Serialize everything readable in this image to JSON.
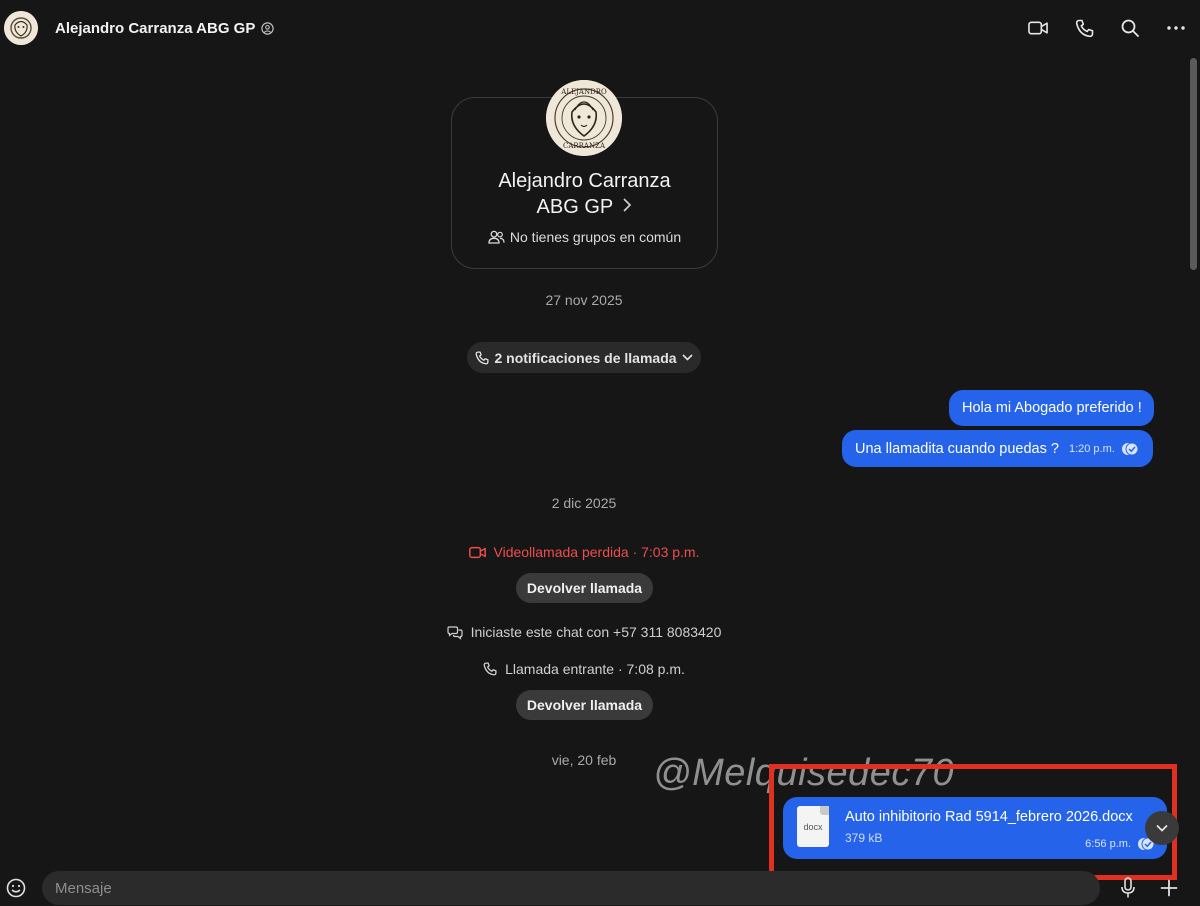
{
  "header": {
    "contact_name": "Alejandro Carranza ABG GP"
  },
  "profile": {
    "avatar_text_top": "ALEJANDRO",
    "avatar_text_bottom": "CARRANZA",
    "name_line1": "Alejandro Carranza",
    "name_line2": "ABG GP",
    "groups_text": "No tienes grupos en común"
  },
  "dates": {
    "first": "27 nov 2025",
    "second": "2 dic 2025",
    "third": "vie, 20 feb"
  },
  "call_notifications": {
    "label": "2 notificaciones de llamada"
  },
  "messages": [
    {
      "text": "Hola mi Abogado preferido !"
    },
    {
      "text": "Una llamadita cuando puedas ?",
      "time": "1:20 p.m."
    }
  ],
  "events": {
    "missed_video_call": "Videollamada perdida · 7:03 p.m.",
    "callback_label": "Devolver llamada",
    "chat_started": "Iniciaste este chat con +57 311 8083420",
    "incoming_call": "Llamada entrante · 7:08 p.m.",
    "callback_label_2": "Devolver llamada"
  },
  "watermark": "@Melquisedec70",
  "document": {
    "type_label": "docx",
    "filename": "Auto inhibitorio Rad 5914_febrero 2026.docx",
    "size": "379 kB",
    "time": "6:56 p.m."
  },
  "composer": {
    "placeholder": "Mensaje"
  },
  "colors": {
    "background": "#161616",
    "bubble_outgoing": "#2663eb",
    "missed_call_red": "#ef4d4d",
    "highlight_red": "#e03022"
  },
  "icons": {
    "header": [
      "video-camera-icon",
      "phone-icon",
      "search-icon",
      "more-options-icon"
    ],
    "composer": [
      "emoji-icon",
      "microphone-icon",
      "plus-icon"
    ]
  }
}
